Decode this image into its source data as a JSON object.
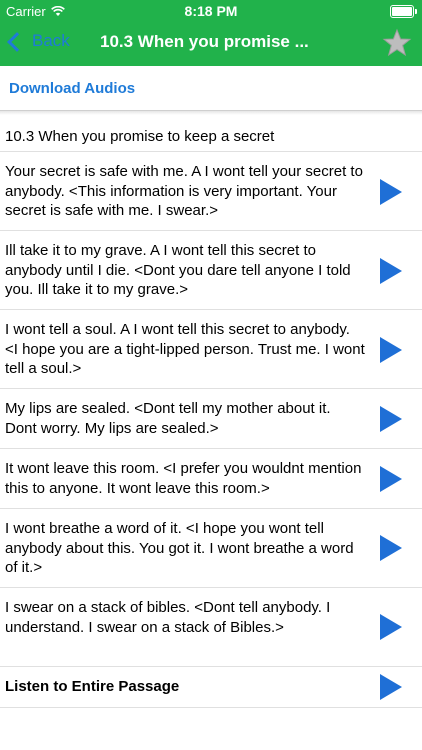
{
  "status": {
    "carrier": "Carrier",
    "time": "8:18 PM"
  },
  "nav": {
    "back_label": "Back",
    "title": "10.3   When you promise ..."
  },
  "download_label": "Download Audios",
  "heading": "10.3   When you promise to keep a secret",
  "items": [
    {
      "text": "Your secret is safe with me.      A I wont tell your secret to anybody.   <This information is very important.  Your secret is safe with me. I swear.>"
    },
    {
      "text": "Ill take it to my grave.      A I wont tell this secret to anybody until I die.   <Dont you dare tell anyone I told you.  Ill take it to my grave.>"
    },
    {
      "text": "I wont tell a soul.      A I wont tell this secret to anybody.   <I hope you are a tight-lipped person.  Trust me. I wont tell a soul.>"
    },
    {
      "text": "My lips are sealed.      <Dont tell my mother about it.  Dont worry. My lips are sealed.>"
    },
    {
      "text": "It wont leave this room.      <I prefer you wouldnt mention this to anyone.  It wont leave this room.>"
    },
    {
      "text": "I wont breathe a word of it.      <I hope you wont tell anybody about this.  You got it. I wont breathe a word of it.>"
    },
    {
      "text": "I swear on a stack of bibles.      <Dont tell anybody.  I understand. I swear on a stack of Bibles.>"
    }
  ],
  "listen_label": "Listen to Entire Passage",
  "colors": {
    "navbar": "#21b24b",
    "link": "#1f7bd8",
    "play": "#1f6fd6"
  },
  "icons": [
    "wifi-icon",
    "battery-icon",
    "back-chevron-icon",
    "star-icon",
    "play-icon"
  ]
}
